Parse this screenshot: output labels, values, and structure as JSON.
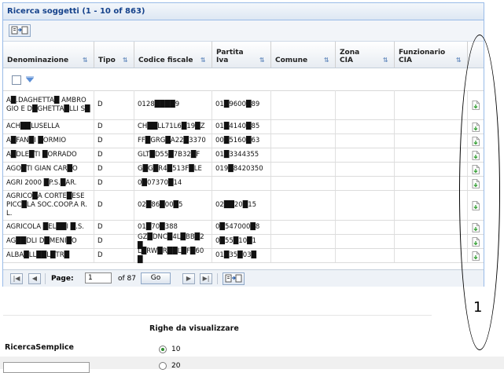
{
  "panel": {
    "title": "Ricerca soggetti (1 - 10 of 863)"
  },
  "grid": {
    "columns": [
      {
        "label": "Denominazione"
      },
      {
        "label": "Tipo"
      },
      {
        "label": "Codice fiscale"
      },
      {
        "label": "Partita\nIva"
      },
      {
        "label": "Comune"
      },
      {
        "label": "Zona\nCIA"
      },
      {
        "label": "Funzionario\nCIA"
      }
    ],
    "rows": [
      {
        "name": "A█.DAGHETTA█ AMBROGIO E D█GHETTA█LLI S█",
        "tipo": "D",
        "cf": "0128████9",
        "piva": "01█9600█89"
      },
      {
        "name": "ACH██LUSELLA",
        "tipo": "D",
        "cf": "CH██LL71L6█19█Z",
        "piva": "01█4140█85"
      },
      {
        "name": "A█FAN█I █ORMIO",
        "tipo": "D",
        "cf": "FF█GRG█A22█3370",
        "piva": "00█5160█63"
      },
      {
        "name": "A█DLE█TI █ORRADO",
        "tipo": "D",
        "cf": "GLT█D55█7B32█F",
        "piva": "01█3344355"
      },
      {
        "name": "AGO█TI GIAN CAR█O",
        "tipo": "D",
        "cf": "G█G█R4█513F█LE",
        "piva": "019█8420350"
      },
      {
        "name": "AGRI 2000 █P.S.█AR.",
        "tipo": "D",
        "cf": "0█07370█14",
        "piva": ""
      },
      {
        "name": "AGRICO█A CORTE█ESE PICC█LA SOC.COOP.A R.L.",
        "tipo": "D",
        "cf": "02█86█00█5",
        "piva": "02██20█15"
      },
      {
        "name": "AGRICOLA █EL██I █.S.",
        "tipo": "D",
        "cf": "01█70█388",
        "piva": "0█547000█8"
      },
      {
        "name": "AG██DLI D█MENI█O",
        "tipo": "D",
        "cf": "GZ█DNC█4L█BB█2█",
        "piva": "0█55█10█1"
      },
      {
        "name": "ALBA█LL██L█TR█",
        "tipo": "D",
        "cf": "L█RW█R██L█F█60█",
        "piva": "01█35█03█"
      }
    ]
  },
  "pager": {
    "page_label": "Page:",
    "page_value": "1",
    "of_label": "of 87",
    "go_label": "Go"
  },
  "annotation": {
    "number": "1"
  },
  "options": {
    "rows_header": "Righe da visualizzare",
    "search_label": "RicercaSemplice",
    "radio_options": [
      {
        "label": "10",
        "selected": true
      },
      {
        "label": "20",
        "selected": false
      }
    ]
  }
}
